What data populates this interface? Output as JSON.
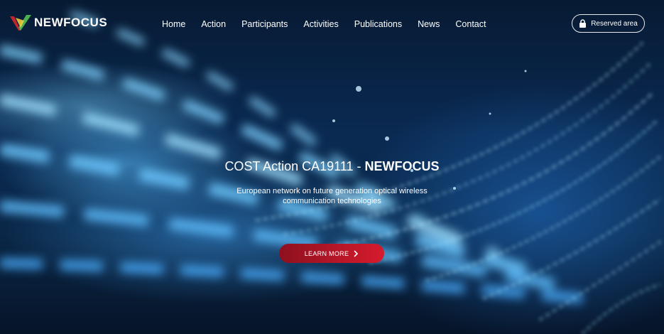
{
  "brand": {
    "name": "NEWFOCUS",
    "logo_icon": "newfocus-logo-icon"
  },
  "nav": {
    "items": [
      {
        "label": "Home"
      },
      {
        "label": "Action"
      },
      {
        "label": "Participants"
      },
      {
        "label": "Activities"
      },
      {
        "label": "Publications"
      },
      {
        "label": "News"
      },
      {
        "label": "Contact"
      }
    ]
  },
  "reserved": {
    "label": "Reserved area",
    "icon": "lock-icon"
  },
  "hero": {
    "title_prefix": "COST Action CA19111 -",
    "title_bold": "NEWFOCUS",
    "subtitle": "European network on future generation optical wireless communication technologies",
    "cta_label": "LEARN MORE",
    "cta_icon": "chevron-right-icon"
  },
  "colors": {
    "cta_start": "#8e1020",
    "cta_end": "#d51b2c",
    "background": "#0a2a52"
  }
}
